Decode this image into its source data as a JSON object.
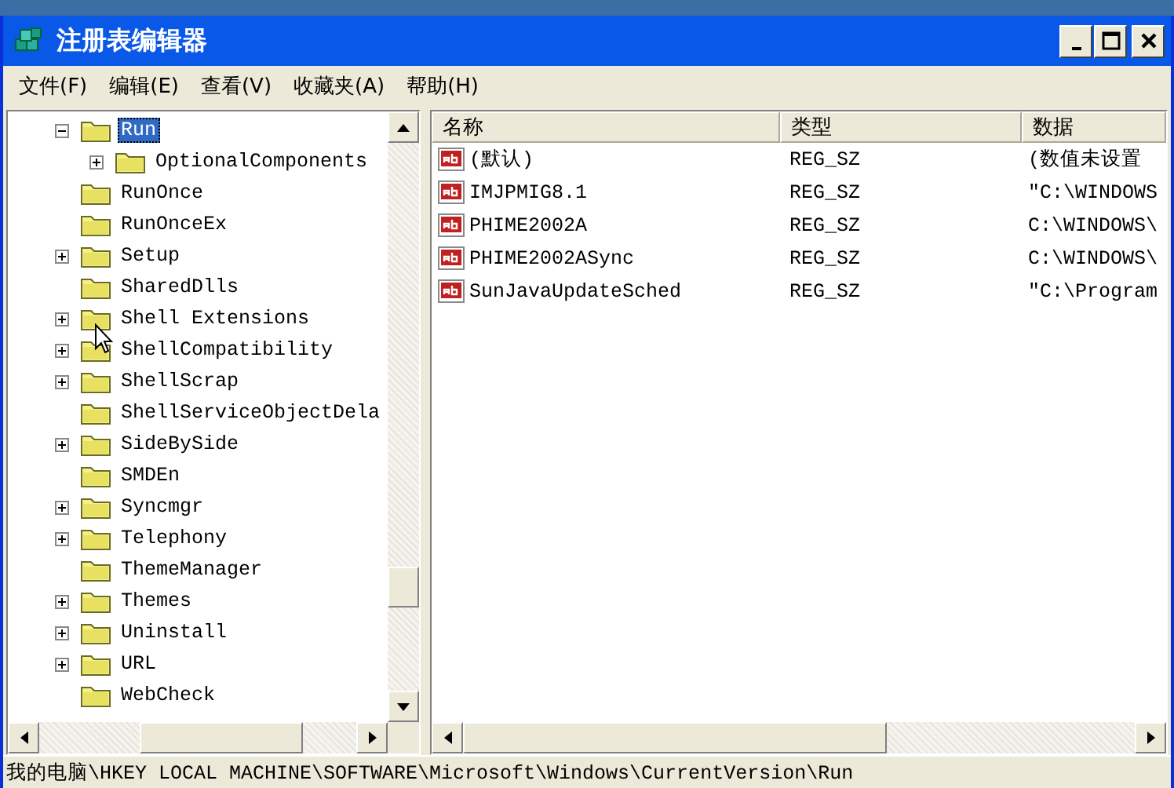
{
  "window": {
    "title": "注册表编辑器"
  },
  "menu": [
    "文件(F)",
    "编辑(E)",
    "查看(V)",
    "收藏夹(A)",
    "帮助(H)"
  ],
  "tree": {
    "items": [
      {
        "label": "Run",
        "expandable": true,
        "expanded": true,
        "selected": true,
        "children": [
          {
            "label": "OptionalComponents",
            "expandable": true,
            "expanded": false,
            "selected": false
          }
        ]
      },
      {
        "label": "RunOnce",
        "expandable": false,
        "selected": false
      },
      {
        "label": "RunOnceEx",
        "expandable": false,
        "selected": false
      },
      {
        "label": "Setup",
        "expandable": true,
        "expanded": false,
        "selected": false
      },
      {
        "label": "SharedDlls",
        "expandable": false,
        "selected": false
      },
      {
        "label": "Shell Extensions",
        "expandable": true,
        "expanded": false,
        "selected": false
      },
      {
        "label": "ShellCompatibility",
        "expandable": true,
        "expanded": false,
        "selected": false
      },
      {
        "label": "ShellScrap",
        "expandable": true,
        "expanded": false,
        "selected": false
      },
      {
        "label": "ShellServiceObjectDela",
        "expandable": false,
        "selected": false
      },
      {
        "label": "SideBySide",
        "expandable": true,
        "expanded": false,
        "selected": false
      },
      {
        "label": "SMDEn",
        "expandable": false,
        "selected": false
      },
      {
        "label": "Syncmgr",
        "expandable": true,
        "expanded": false,
        "selected": false
      },
      {
        "label": "Telephony",
        "expandable": true,
        "expanded": false,
        "selected": false
      },
      {
        "label": "ThemeManager",
        "expandable": false,
        "selected": false
      },
      {
        "label": "Themes",
        "expandable": true,
        "expanded": false,
        "selected": false
      },
      {
        "label": "Uninstall",
        "expandable": true,
        "expanded": false,
        "selected": false
      },
      {
        "label": "URL",
        "expandable": true,
        "expanded": false,
        "selected": false
      },
      {
        "label": "WebCheck",
        "expandable": false,
        "selected": false
      }
    ]
  },
  "values": {
    "columns": [
      "名称",
      "类型",
      "数据"
    ],
    "rows": [
      {
        "name": "(默认)",
        "type": "REG_SZ",
        "data": "(数值未设置"
      },
      {
        "name": "IMJPMIG8.1",
        "type": "REG_SZ",
        "data": "\"C:\\WINDOWS"
      },
      {
        "name": "PHIME2002A",
        "type": "REG_SZ",
        "data": "C:\\WINDOWS\\"
      },
      {
        "name": "PHIME2002ASync",
        "type": "REG_SZ",
        "data": "C:\\WINDOWS\\"
      },
      {
        "name": "SunJavaUpdateSched",
        "type": "REG_SZ",
        "data": "\"C:\\Program"
      }
    ]
  },
  "status_bar": "我的电脑\\HKEY LOCAL MACHINE\\SOFTWARE\\Microsoft\\Windows\\CurrentVersion\\Run"
}
